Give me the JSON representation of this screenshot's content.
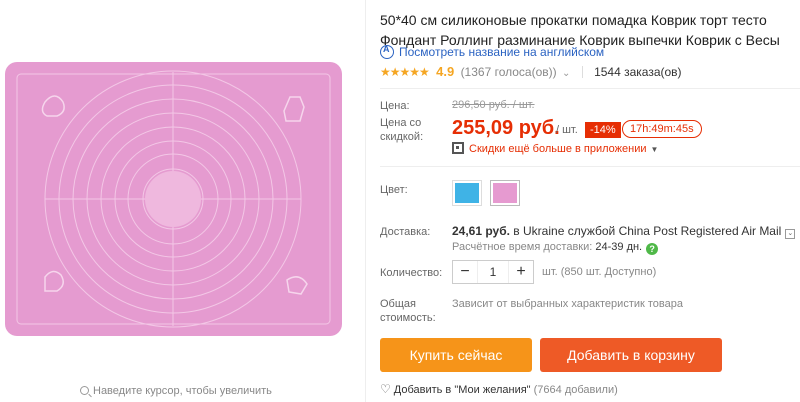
{
  "image_panel": {
    "zoom_hint": "Наведите курсор, чтобы увеличить"
  },
  "product": {
    "title": "50*40 см силиконовые прокатки помадка Коврик торт тесто Фондант Роллинг разминание Коврик выпечки Коврик с Весы",
    "translate_link": "Посмотреть название на английском",
    "rating": {
      "stars": "★★★★★",
      "value": "4.9",
      "votes": "(1367 голоса(ов))",
      "orders": "1544 заказа(ов)"
    },
    "price": {
      "label": "Цена:",
      "old": "296,50 руб. / шт.",
      "discount_label": "Цена со скидкой:",
      "new": "255,09 руб.",
      "unit": "/ шт.",
      "discount": "-14%",
      "timer": "17h:49m:45s",
      "app_promo": "Скидки ещё больше в приложении"
    },
    "color": {
      "label": "Цвет:"
    },
    "shipping": {
      "label": "Доставка:",
      "price": "24,61 руб.",
      "route": " в Ukraine службой China Post Registered Air Mail",
      "time_label": "Расчётное время доставки:",
      "time_value": "24-39 дн."
    },
    "quantity": {
      "label": "Количество:",
      "minus": "−",
      "value": "1",
      "plus": "+",
      "available": "шт. (850 шт. Доступно)"
    },
    "total": {
      "label": "Общая стоимость:",
      "note": "Зависит от выбранных характеристик товара"
    },
    "actions": {
      "buy_now": "Купить сейчас",
      "add_to_cart": "Добавить в корзину",
      "wishlist": "Добавить в \"Мои желания\"",
      "wishlist_count": "(7664 добавили)"
    }
  },
  "colors": {
    "mat_pink": "#e59bd0",
    "price_red": "#e62e04",
    "buy_orange": "#f69419",
    "cart_orange": "#ee5a26",
    "link_blue": "#2b63c2"
  }
}
